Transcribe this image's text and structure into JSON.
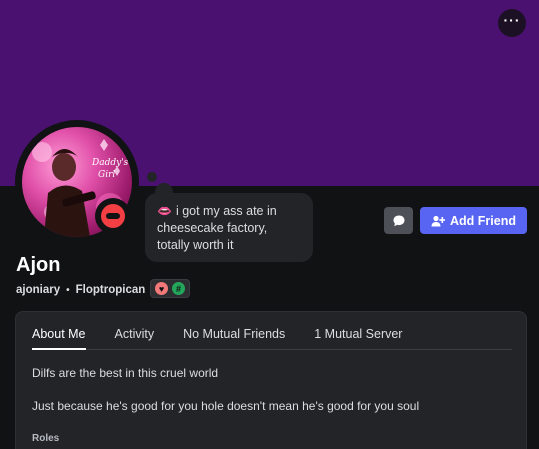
{
  "profile": {
    "display_name": "Ajon",
    "username": "ajoniary",
    "pronouns_tag": "Floptropican",
    "status": "do-not-disturb",
    "banner_color": "#4b1170",
    "avatar_text_1": "Daddy's",
    "avatar_text_2": "Girl"
  },
  "custom_status": {
    "emoji": "lips-emoji",
    "text": "i got my ass ate in cheesecake factory, totally worth it"
  },
  "actions": {
    "more_label": "···",
    "message_icon": "chat-bubble-icon",
    "add_friend_label": "Add Friend"
  },
  "badges": [
    {
      "name": "heart-badge",
      "glyph": "♥",
      "color": "#f2797a"
    },
    {
      "name": "hashtag-badge",
      "glyph": "#",
      "color": "#23a55a"
    }
  ],
  "tabs": [
    {
      "label": "About Me",
      "active": true
    },
    {
      "label": "Activity",
      "active": false
    },
    {
      "label": "No Mutual Friends",
      "active": false
    },
    {
      "label": "1 Mutual Server",
      "active": false
    }
  ],
  "about": {
    "line1": "Dilfs are the best in this cruel world",
    "line2": "Just because he's good for you hole doesn't mean he's good for you soul",
    "roles_label": "Roles"
  }
}
